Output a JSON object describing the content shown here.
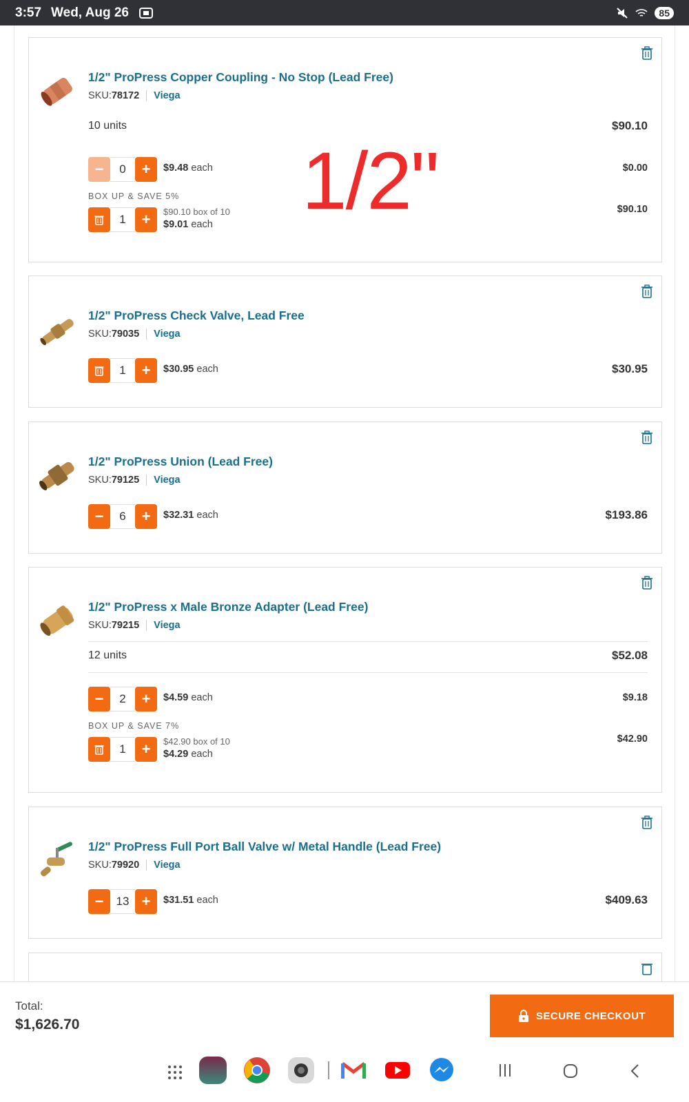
{
  "status_bar": {
    "time": "3:57",
    "date": "Wed, Aug 26",
    "battery": "85"
  },
  "overlay_text": "1/2\"",
  "items": [
    {
      "title": "1/2\" ProPress Copper Coupling - No Stop (Lead Free)",
      "sku_label": "SKU:",
      "sku": "78172",
      "brand": "Viega",
      "units": "10 units",
      "line_total": "$90.10",
      "single": {
        "qty": "0",
        "price": "$9.48",
        "each_label": "each",
        "subtotal": "$0.00"
      },
      "box": {
        "label": "BOX UP & SAVE 5%",
        "qty": "1",
        "box_price": "$90.10 box of 10",
        "price": "$9.01",
        "each_label": "each",
        "subtotal": "$90.10"
      }
    },
    {
      "title": "1/2\" ProPress Check Valve, Lead Free",
      "sku_label": "SKU:",
      "sku": "79035",
      "brand": "Viega",
      "qty": "1",
      "price": "$30.95",
      "each_label": "each",
      "line_total": "$30.95"
    },
    {
      "title": "1/2\" ProPress Union (Lead Free)",
      "sku_label": "SKU:",
      "sku": "79125",
      "brand": "Viega",
      "qty": "6",
      "price": "$32.31",
      "each_label": "each",
      "line_total": "$193.86"
    },
    {
      "title": "1/2\" ProPress x Male Bronze Adapter (Lead Free)",
      "sku_label": "SKU:",
      "sku": "79215",
      "brand": "Viega",
      "units": "12 units",
      "line_total": "$52.08",
      "single": {
        "qty": "2",
        "price": "$4.59",
        "each_label": "each",
        "subtotal": "$9.18"
      },
      "box": {
        "label": "BOX UP & SAVE 7%",
        "qty": "1",
        "box_price": "$42.90 box of 10",
        "price": "$4.29",
        "each_label": "each",
        "subtotal": "$42.90"
      }
    },
    {
      "title": "1/2\" ProPress Full Port Ball Valve w/ Metal Handle (Lead Free)",
      "sku_label": "SKU:",
      "sku": "79920",
      "brand": "Viega",
      "qty": "13",
      "price": "$31.51",
      "each_label": "each",
      "line_total": "$409.63"
    }
  ],
  "stepper_symbols": {
    "minus": "−",
    "plus": "+"
  },
  "footer": {
    "total_label": "Total:",
    "total_value": "$1,626.70",
    "checkout_label": "SECURE CHECKOUT"
  },
  "icons": {
    "trash": "trash-icon",
    "lock": "lock-icon"
  },
  "colors": {
    "accent": "#f26b12",
    "link": "#1a6f8e",
    "overlay": "#ee2b2b"
  }
}
